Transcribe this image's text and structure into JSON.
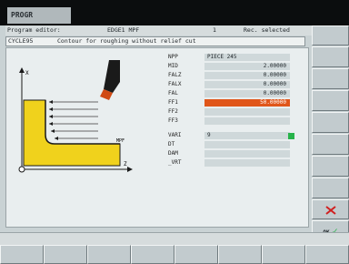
{
  "header": {
    "mode_label": "PROGR"
  },
  "status_bar": {
    "left_text": "Program editor:",
    "program": "EDGE1 MPF",
    "channel": "1",
    "state": "Rec. selected"
  },
  "cycle_title": {
    "cycle": "CYCLE95",
    "description": "Contour for roughing without relief cut"
  },
  "sketch": {
    "axis_x_label": "Z",
    "axis_y_label": "X",
    "finish_label": "MPF"
  },
  "parameters": [
    {
      "label": "NPP",
      "value": "PIECE 245"
    },
    {
      "label": "MID",
      "value": "2.00000"
    },
    {
      "label": "FALZ",
      "value": "0.00000"
    },
    {
      "label": "FALX",
      "value": "0.00000"
    },
    {
      "label": "FAL",
      "value": "0.00000"
    },
    {
      "label": "FF1",
      "value": "50.00000"
    },
    {
      "label": "FF2",
      "value": ""
    },
    {
      "label": "FF3",
      "value": ""
    },
    {
      "label": "VARI",
      "value": "9"
    },
    {
      "label": "DT",
      "value": ""
    },
    {
      "label": "DAM",
      "value": ""
    },
    {
      "label": "_VRT",
      "value": ""
    }
  ],
  "right_softkeys": {
    "ok_label": "OK"
  },
  "colors": {
    "accent": "#e0561a",
    "workpiece": "#f0d21c",
    "tool": "#d04a14",
    "check": "#27b34a"
  }
}
